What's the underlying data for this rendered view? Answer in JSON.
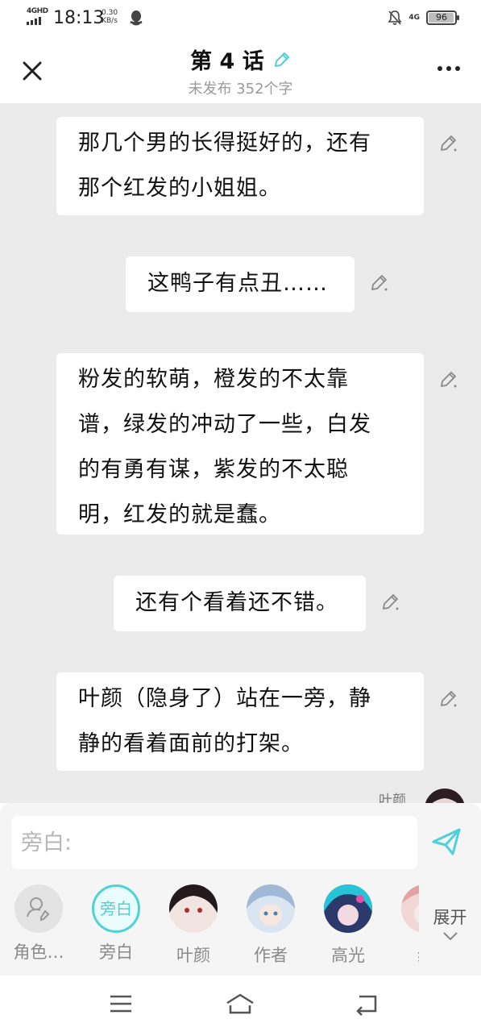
{
  "status_bar": {
    "network": "4GHD",
    "time": "18:13",
    "speed_value": "0.30",
    "speed_unit": "KB/s",
    "right_network": "4G",
    "battery": "96",
    "battery_level": 0.96
  },
  "header": {
    "title": "第 4 话",
    "subtitle": "未发布 352个字"
  },
  "messages": [
    {
      "lines": [
        "那几个男的长得挺好的，还有",
        "那个红发的小姐姐。"
      ]
    },
    {
      "lines": [
        "这鸭子有点丑……"
      ]
    },
    {
      "lines": [
        "粉发的软萌，橙发的不太靠",
        "谱，绿发的冲动了一些，白发",
        "的有勇有谋，紫发的不太聪",
        "明，红发的就是蠢。"
      ]
    },
    {
      "lines": [
        "还有个看着还不错。"
      ]
    },
    {
      "lines": [
        "叶颜（隐身了）站在一旁，静",
        "静的看着面前的打架。"
      ]
    }
  ],
  "peek_message": {
    "name": "叶颜"
  },
  "input": {
    "placeholder": "旁白:"
  },
  "roles": [
    {
      "label": "角色…",
      "avatar": "add-role-icon"
    },
    {
      "label": "旁白",
      "avatar_text": "旁白"
    },
    {
      "label": "叶颜"
    },
    {
      "label": "作者"
    },
    {
      "label": "高光"
    },
    {
      "label": "纟"
    }
  ],
  "expand_label": "展开",
  "colors": {
    "accent": "#4fd1d9",
    "background": "#ebebeb",
    "panel": "#f5f5f5"
  }
}
